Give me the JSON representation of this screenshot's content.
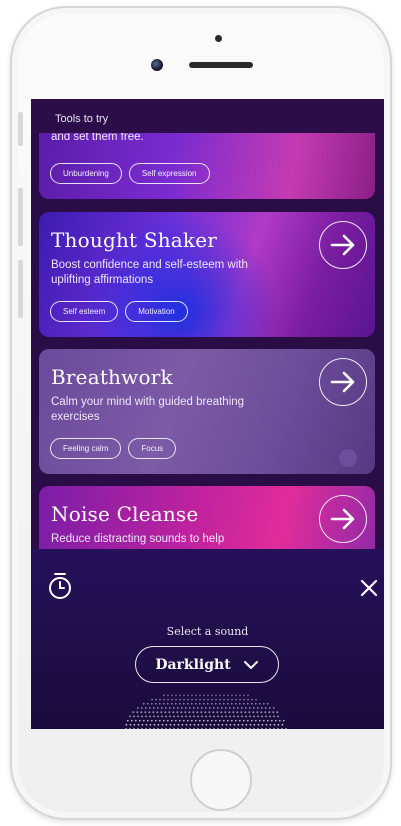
{
  "header": {
    "title": "Tools to try"
  },
  "cards": [
    {
      "description": "and set them free.",
      "tags": [
        "Unburdening",
        "Self expression"
      ]
    },
    {
      "title": "Thought Shaker",
      "description": "Boost confidence and self-esteem with uplifting affirmations",
      "tags": [
        "Self esteem",
        "Motivation"
      ]
    },
    {
      "title": "Breathwork",
      "description": "Calm your mind with guided breathing exercises",
      "tags": [
        "Feeling calm",
        "Focus"
      ]
    },
    {
      "title": "Noise Cleanse",
      "description": "Reduce distracting sounds to help"
    }
  ],
  "player": {
    "select_label": "Select a sound",
    "selected_sound": "Darklight"
  },
  "icons": {
    "arrow": "arrow-right-icon",
    "timer": "timer-icon",
    "close": "close-icon",
    "chevron": "chevron-down-icon"
  }
}
